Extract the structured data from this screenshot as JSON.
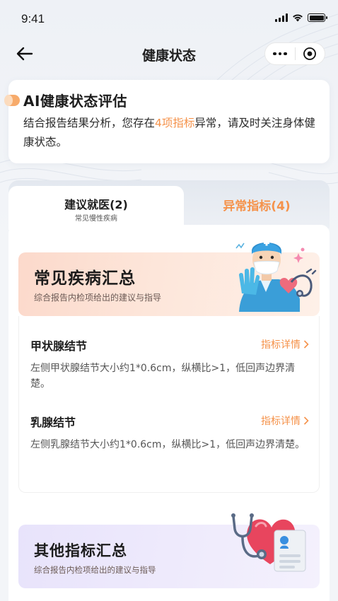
{
  "status_bar": {
    "time": "9:41"
  },
  "nav": {
    "title": "健康状态"
  },
  "ai_card": {
    "title": "AI健康状态评估",
    "desc_before": "结合报告结果分析，您存在",
    "desc_highlight": "4项指标",
    "desc_after": "异常，请及时关注身体健康状态。"
  },
  "tabs": {
    "left_title": "建议就医(2)",
    "left_sub": "常见慢性疾病",
    "right_title": "异常指标(4)"
  },
  "section1": {
    "title": "常见疾病汇总",
    "subtitle": "综合报告内检项给出的建议与指导",
    "items": [
      {
        "name": "甲状腺结节",
        "link": "指标详情",
        "desc": "左侧甲状腺结节大小约1*0.6cm，纵横比>1，低回声边界清楚。"
      },
      {
        "name": "乳腺结节",
        "link": "指标详情",
        "desc": "左侧乳腺结节大小约1*0.6cm，纵横比>1，低回声边界清楚。"
      }
    ]
  },
  "section2": {
    "title": "其他指标汇总",
    "subtitle": "综合报告内检项给出的建议与指导"
  },
  "colors": {
    "accent": "#f5924a",
    "section1_bg": "#fcd9cb",
    "section2_bg": "#e8e3fb"
  },
  "icons": [
    "back-arrow-icon",
    "more-dots-icon",
    "close-target-icon",
    "chevron-right-icon",
    "signal-icon",
    "wifi-icon",
    "battery-icon"
  ]
}
